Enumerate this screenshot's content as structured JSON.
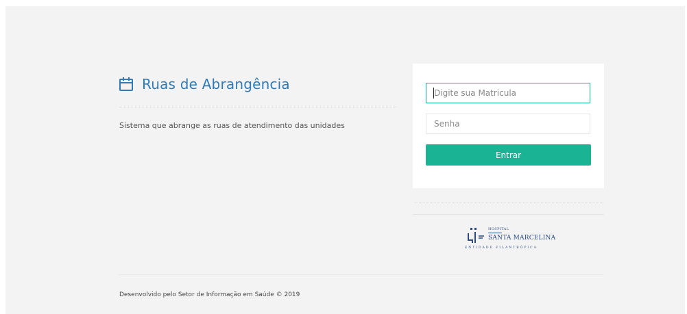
{
  "brand": {
    "title": "Ruas de Abrangência",
    "icon": "calendar-icon",
    "color": "#2f79b5"
  },
  "description": "Sistema que abrange as ruas de atendimento das unidades",
  "login": {
    "matricula_placeholder": "Digite sua Matricula",
    "matricula_value": "",
    "senha_placeholder": "Senha",
    "senha_value": "",
    "submit_label": "Entrar",
    "accent_color": "#1ab394"
  },
  "logo": {
    "line1": "HOSPITAL",
    "line2": "SANTA MARCELINA",
    "line3": "ENTIDADE FILANTRÓPICA"
  },
  "footer": {
    "text": "Desenvolvido pelo Setor de Informação em Saúde © 2019"
  }
}
